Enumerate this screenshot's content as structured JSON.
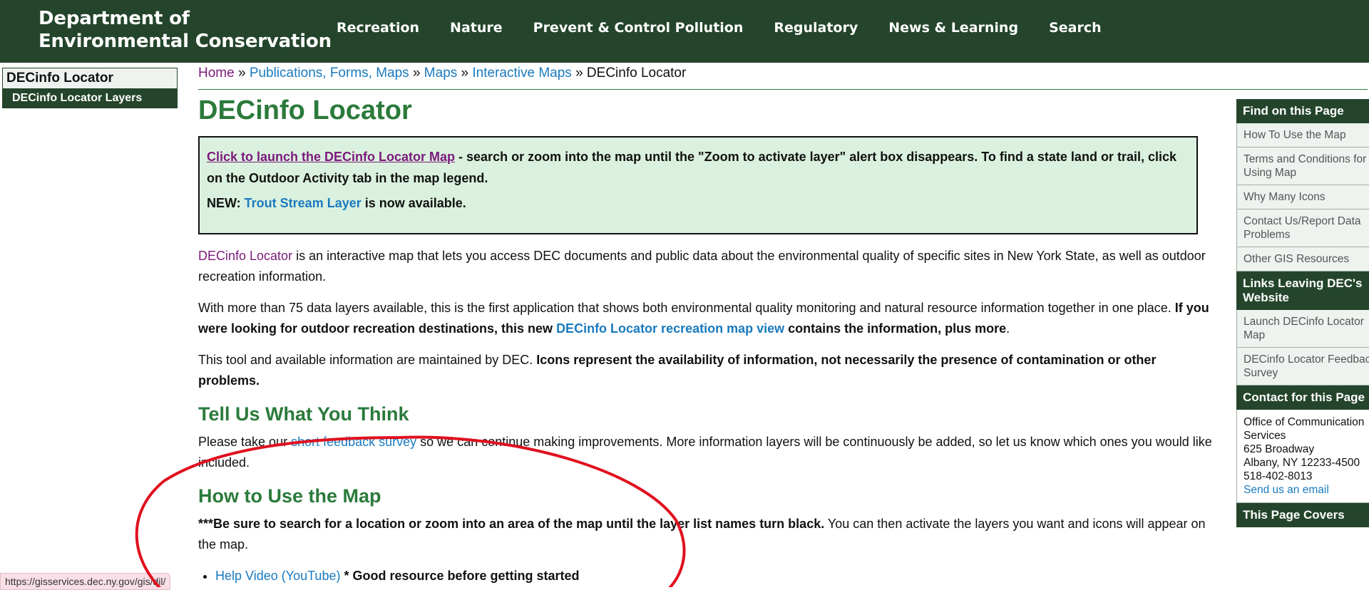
{
  "header": {
    "brand_line1": "Department of",
    "brand_line2": "Environmental Conservation",
    "nav": [
      "Recreation",
      "Nature",
      "Prevent & Control Pollution",
      "Regulatory",
      "News & Learning",
      "Search"
    ]
  },
  "left_nav": {
    "title": "DECinfo Locator",
    "sub": "DECinfo Locator Layers"
  },
  "breadcrumb": {
    "home": "Home",
    "items": [
      "Publications, Forms, Maps",
      "Maps",
      "Interactive Maps"
    ],
    "current": "DECinfo Locator",
    "sep": " » "
  },
  "page": {
    "title": "DECinfo Locator",
    "notice": {
      "launch_link": "Click to launch the DECinfo Locator Map",
      "launch_rest": " - search or zoom into the map until the \"Zoom to activate layer\" alert box disappears. To find a state land or trail, click on the Outdoor Activity tab in the map legend.",
      "new_label": "NEW: ",
      "trout_link": "Trout Stream Layer",
      "trout_rest": " is now available."
    },
    "p1_link": "DECinfo Locator",
    "p1_rest": " is an interactive map that lets you access DEC documents and public data about the environmental quality of specific sites in New York State, as well as outdoor recreation information.",
    "p2_a": "With more than 75 data layers available, this is the first application that shows both environmental quality monitoring and natural resource information together in one place. ",
    "p2_bold": "If you were looking for outdoor recreation destinations, this new ",
    "p2_link": "DECinfo Locator recreation map view",
    "p2_bold2": " contains the information, plus more",
    "p2_end": ".",
    "p3_a": "This tool and available information are maintained by DEC. ",
    "p3_bold": "Icons represent the availability of information, not necessarily the presence of contamination or other problems.",
    "h2_feedback": "Tell Us What You Think",
    "p4_a": "Please take our ",
    "p4_link": "short feedback survey",
    "p4_b": " so we can continue making improvements. More information layers will be continuously be added, so let us know which ones you would like included.",
    "h2_howto": "How to Use the Map",
    "p5_bold": "***Be sure to search for a location or zoom into an area of the map until the layer list names turn black.",
    "p5_rest": " You can then activate the layers you want and icons will appear on the map.",
    "li1_link": "Help Video (YouTube)",
    "li1_bold": " * Good resource before getting started"
  },
  "right_nav": {
    "find_head": "Find on this Page",
    "find_items": [
      "How To Use the Map",
      "Terms and Conditions for Using Map",
      "Why Many Icons",
      "Contact Us/Report Data Problems",
      "Other GIS Resources"
    ],
    "links_head": "Links Leaving DEC's Website",
    "links_items": [
      "Launch DECinfo Locator Map",
      "DECinfo Locator Feedback Survey"
    ],
    "contact_head": "Contact for this Page",
    "contact_lines": [
      "Office of Communication Services",
      "625 Broadway",
      "Albany, NY 12233-4500",
      "518-402-8013"
    ],
    "contact_email": "Send us an email",
    "covers_head": "This Page Covers"
  },
  "status_url": "https://gisservices.dec.ny.gov/gis/dil/",
  "colors": {
    "header_bg": "#24452b",
    "heading_green": "#2b7a3b",
    "link_blue": "#1a7abf",
    "visited_purple": "#7a1a7a",
    "notice_bg": "#dbf1df",
    "annotation_red": "#e0101e"
  }
}
